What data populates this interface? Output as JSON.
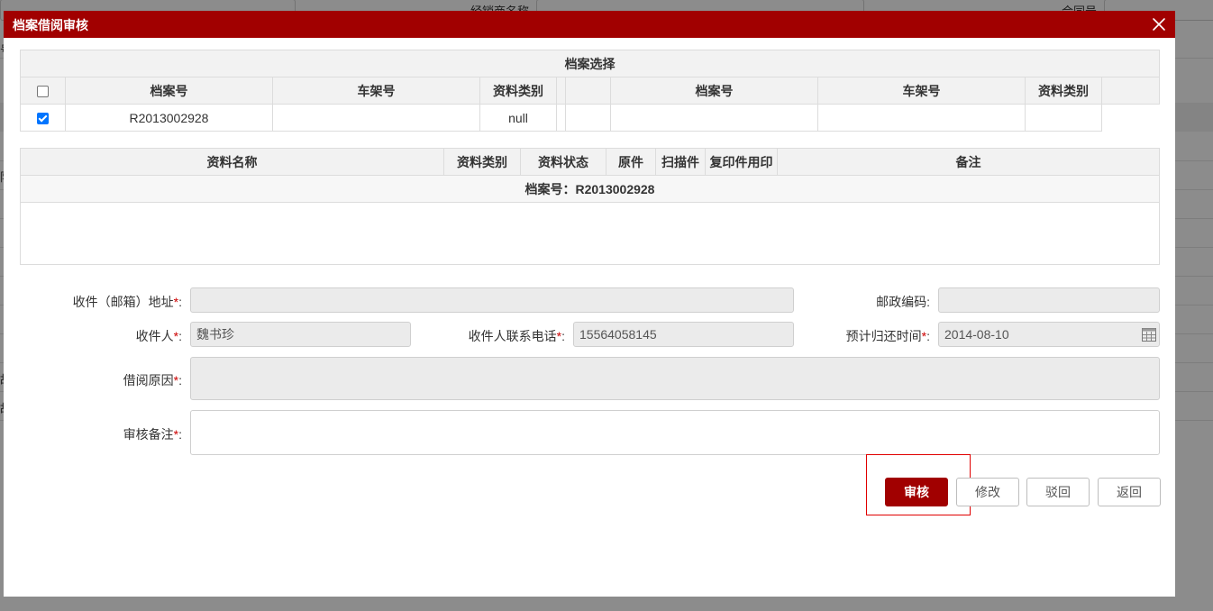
{
  "background": {
    "label_a": "经销商名称",
    "label_b": "合同号",
    "side_glyph_a": "号",
    "side_glyph_b": "限",
    "side_glyph_c": "故",
    "side_glyph_d": "故"
  },
  "dialog": {
    "title": "档案借阅审核",
    "close_icon": "close-icon"
  },
  "archive_table": {
    "title": "档案选择",
    "headers": [
      "档案号",
      "车架号",
      "资料类别"
    ],
    "right_headers": [
      "档案号",
      "车架号",
      "资料类别"
    ],
    "rows": [
      {
        "checked": true,
        "archive_no": "R2013002928",
        "vin": "",
        "category": "null"
      }
    ]
  },
  "materials_table": {
    "headers": {
      "name": "资料名称",
      "category": "资料类别",
      "status": "资料状态",
      "original": "原件",
      "scan": "扫描件",
      "copy_seal": "复印件用印",
      "remark": "备注"
    },
    "group_label": "档案号：R2013002928"
  },
  "form": {
    "address_label": "收件（邮箱）地址",
    "address_value": "",
    "postcode_label": "邮政编码:",
    "postcode_value": "",
    "recipient_label": "收件人",
    "recipient_value": "魏书珍",
    "phone_label": "收件人联系电话",
    "phone_value": "15564058145",
    "return_time_label": "预计归还时间",
    "return_time_value": "2014-08-10",
    "reason_label": "借阅原因",
    "reason_value": "",
    "review_note_label": "审核备注",
    "review_note_value": "",
    "required_mark": "*",
    "colon": ":"
  },
  "buttons": {
    "approve": "审核",
    "modify": "修改",
    "reject": "驳回",
    "back": "返回"
  },
  "colors": {
    "brand": "#a10000",
    "highlight": "#e00000"
  }
}
